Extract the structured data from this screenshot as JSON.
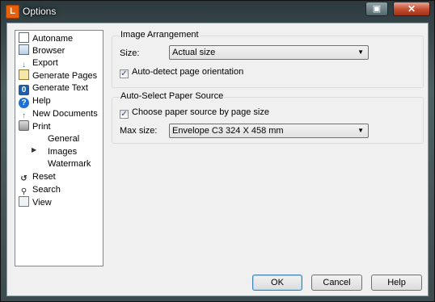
{
  "window": {
    "title": "Options",
    "app_icon_letter": "L"
  },
  "tree": {
    "items": [
      {
        "label": "Autoname",
        "icon": "document-icon"
      },
      {
        "label": "Browser",
        "icon": "browser-icon"
      },
      {
        "label": "Export",
        "icon": "export-arrow-icon"
      },
      {
        "label": "Generate Pages",
        "icon": "generate-pages-icon"
      },
      {
        "label": "Generate Text",
        "icon": "generate-text-icon"
      },
      {
        "label": "Help",
        "icon": "help-icon"
      },
      {
        "label": "New Documents",
        "icon": "new-document-arrow-icon"
      },
      {
        "label": "Print",
        "icon": "printer-icon"
      }
    ],
    "print_children": [
      "General",
      "Images",
      "Watermark"
    ],
    "bottom_items": [
      {
        "label": "Reset",
        "icon": "reset-icon"
      },
      {
        "label": "Search",
        "icon": "search-icon"
      },
      {
        "label": "View",
        "icon": "view-icon"
      }
    ],
    "selected": "Images"
  },
  "image_arrangement": {
    "title": "Image Arrangement",
    "size_label": "Size:",
    "size_value": "Actual size",
    "auto_detect_label": "Auto-detect page orientation",
    "auto_detect_checked": true
  },
  "paper_source": {
    "title": "Auto-Select Paper Source",
    "choose_label": "Choose paper source by page size",
    "choose_checked": true,
    "max_size_label": "Max size:",
    "max_size_value": "Envelope C3 324 X 458 mm"
  },
  "buttons": {
    "ok": "OK",
    "cancel": "Cancel",
    "help": "Help"
  }
}
